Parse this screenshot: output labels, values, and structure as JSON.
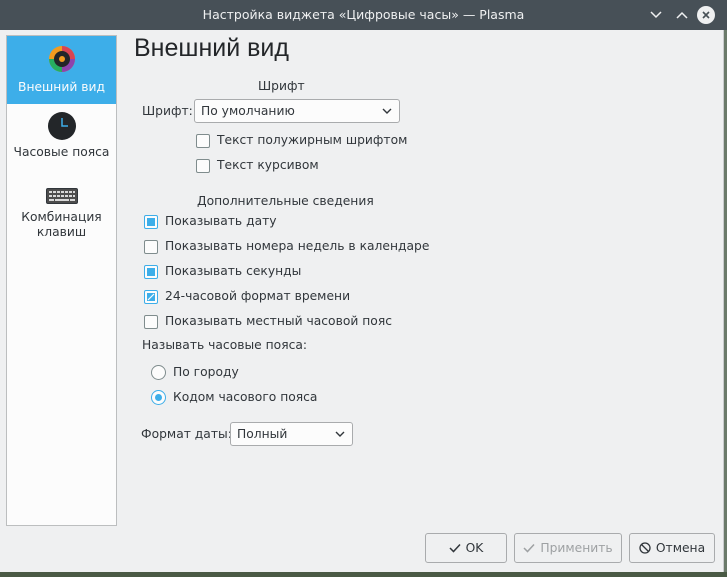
{
  "window": {
    "title": "Настройка виджета «Цифровые часы» — Plasma",
    "controls": [
      "chevron-down-icon",
      "chevron-up-icon",
      "close-icon"
    ]
  },
  "sidebar": {
    "items": [
      {
        "label": "Внешний вид",
        "icon": "appearance-color-wheel-icon",
        "active": true
      },
      {
        "label": "Часовые пояса",
        "icon": "clock-icon",
        "active": false
      },
      {
        "label_line1": "Комбинация",
        "label_line2": "клавиш",
        "icon": "keyboard-icon",
        "active": false
      }
    ]
  },
  "page": {
    "heading": "Внешний вид",
    "font_section": {
      "title": "Шрифт",
      "font_label": "Шрифт:",
      "font_value": "По умолчанию",
      "bold_label": "Текст полужирным шрифтом",
      "bold_checked": false,
      "italic_label": "Текст курсивом",
      "italic_checked": false
    },
    "info_section": {
      "title": "Дополнительные сведения",
      "show_date": {
        "label": "Показывать дату",
        "checked": true
      },
      "show_week_numbers": {
        "label": "Показывать номера недель в календаре",
        "checked": false
      },
      "show_seconds": {
        "label": "Показывать секунды",
        "checked": true
      },
      "format_24h": {
        "label": "24-часовой формат времени",
        "checked": "partial"
      },
      "show_local_tz": {
        "label": "Показывать местный часовой пояс",
        "checked": false
      },
      "tz_naming_label": "Называть часовые пояса:",
      "by_city": {
        "label": "По городу",
        "selected": false
      },
      "by_code": {
        "label": "Кодом часового пояса",
        "selected": true
      },
      "date_format_label": "Формат даты:",
      "date_format_value": "Полный"
    }
  },
  "buttons": {
    "ok": "OK",
    "apply": "Применить",
    "cancel": "Отмена"
  },
  "colors": {
    "accent": "#3daee9",
    "titlebar": "#475057",
    "window_bg": "#eff0f1"
  }
}
